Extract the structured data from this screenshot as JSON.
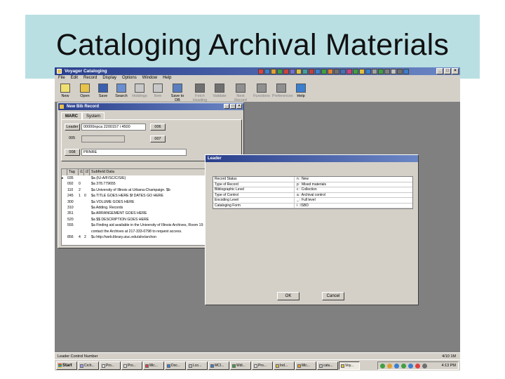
{
  "slide": {
    "title": "Cataloging Archival Materials"
  },
  "app": {
    "title": "Voyager Cataloging",
    "menu": [
      "File",
      "Edit",
      "Record",
      "Display",
      "Options",
      "Window",
      "Help"
    ],
    "toolbar": [
      {
        "label": "New",
        "icon": "new-icon",
        "color": "#f0e070"
      },
      {
        "label": "Open",
        "icon": "open-folder-icon",
        "color": "#e8c34a"
      },
      {
        "label": "Save",
        "icon": "save-disk-icon",
        "color": "#3a5fb0"
      },
      {
        "label": "Search",
        "icon": "search-icon",
        "color": "#6a8fd0"
      },
      {
        "label": "Holdings",
        "icon": "holdings-icon",
        "color": "#c8c8c8",
        "disabled": true
      },
      {
        "label": "Item",
        "icon": "item-icon",
        "color": "#c8c8c8",
        "disabled": true
      },
      {
        "label": "Save to DB",
        "icon": "save-to-db-icon",
        "color": "#5a7fc0"
      },
      {
        "label": "Fetch Heading",
        "icon": "fetch-heading-icon",
        "color": "#707070",
        "disabled": true
      },
      {
        "label": "Validate",
        "icon": "validate-icon",
        "color": "#707070",
        "disabled": true
      },
      {
        "label": "Next Record",
        "icon": "next-record-icon",
        "color": "#909090",
        "disabled": true
      },
      {
        "label": "Functions",
        "icon": "functions-icon",
        "color": "#909090",
        "disabled": true
      },
      {
        "label": "Preferences",
        "icon": "preferences-icon",
        "color": "#909090",
        "disabled": true
      },
      {
        "label": "Help",
        "icon": "help-icon",
        "color": "#3a7fd0"
      }
    ]
  },
  "bib_record": {
    "title": "New Bib Record",
    "tabs": [
      "MARC",
      "System"
    ],
    "leader_label": "Leader",
    "leader_value": "00000npca 2200157 i 4500",
    "btn_006": "006",
    "label_005": "005",
    "btn_007": "007",
    "btn_008": "008",
    "field_008_value": "PRNRE",
    "columns": [
      "Tag",
      "i1",
      "i2",
      "Subfield Data"
    ],
    "rows": [
      {
        "mark": "▸",
        "tag": "035",
        "i1": "",
        "i2": "",
        "data": "$a (IU-A/F/SC/C/S/E)"
      },
      {
        "mark": "",
        "tag": "092",
        "i1": "0",
        "i2": "",
        "data": "$a 378.779655"
      },
      {
        "mark": "",
        "tag": "110",
        "i1": "2",
        "i2": "",
        "data": "$a University of Illinois at Urbana-Champaign. $b"
      },
      {
        "mark": "",
        "tag": "245",
        "i1": "1",
        "i2": "0",
        "data": "$a TITLE GOES HERE $f DATES GO HERE"
      },
      {
        "mark": "",
        "tag": "300",
        "i1": "",
        "i2": "",
        "data": "$a VOLUME GOES HERE"
      },
      {
        "mark": "",
        "tag": "310",
        "i1": "",
        "i2": "",
        "data": "$a Adding. Records"
      },
      {
        "mark": "",
        "tag": "351",
        "i1": "",
        "i2": "",
        "data": "$a ARRANGEMENT GOES HERE"
      },
      {
        "mark": "",
        "tag": "520",
        "i1": "",
        "i2": "",
        "data": "$a $$ DESCRIPTION GOES HERE"
      },
      {
        "mark": "",
        "tag": "555",
        "i1": "",
        "i2": "",
        "data": "$a Finding aid available in the University of Illinois Archives, Room 19"
      },
      {
        "mark": "",
        "tag": "",
        "i1": "",
        "i2": "",
        "data": "contact the Archives at 217-333-0798 to request access."
      },
      {
        "mark": "",
        "tag": "856",
        "i1": "4",
        "i2": "2",
        "data": "$u http://web.library.uiuc.edu/ahx/archon"
      }
    ]
  },
  "loader": {
    "title": "Leader",
    "rows": [
      {
        "label": "Record Status",
        "value": "n : New"
      },
      {
        "label": "Type of Record",
        "value": "p : Mixed materials"
      },
      {
        "label": "Bibliographic Level",
        "value": "c : Collection"
      },
      {
        "label": "Type of Control",
        "value": "a : Archival control"
      },
      {
        "label": "Encoding Level",
        "value": "_ : Full level"
      },
      {
        "label": "Cataloging Form",
        "value": "i : ISBD"
      }
    ],
    "ok_label": "OK",
    "cancel_label": "Cancel"
  },
  "status": {
    "left": "Leader Control Number",
    "right": "4/10 1M"
  },
  "taskbar": {
    "start": "Start",
    "buttons": [
      "Crch...",
      "Pro...",
      "Pro...",
      "Mic...",
      "Doc...",
      "Lco...",
      "MCI...",
      "Wdi...",
      "Pro...",
      "Ind...",
      "Mic...",
      "catu...",
      "Voy..."
    ],
    "clock": "4:13 PM"
  }
}
